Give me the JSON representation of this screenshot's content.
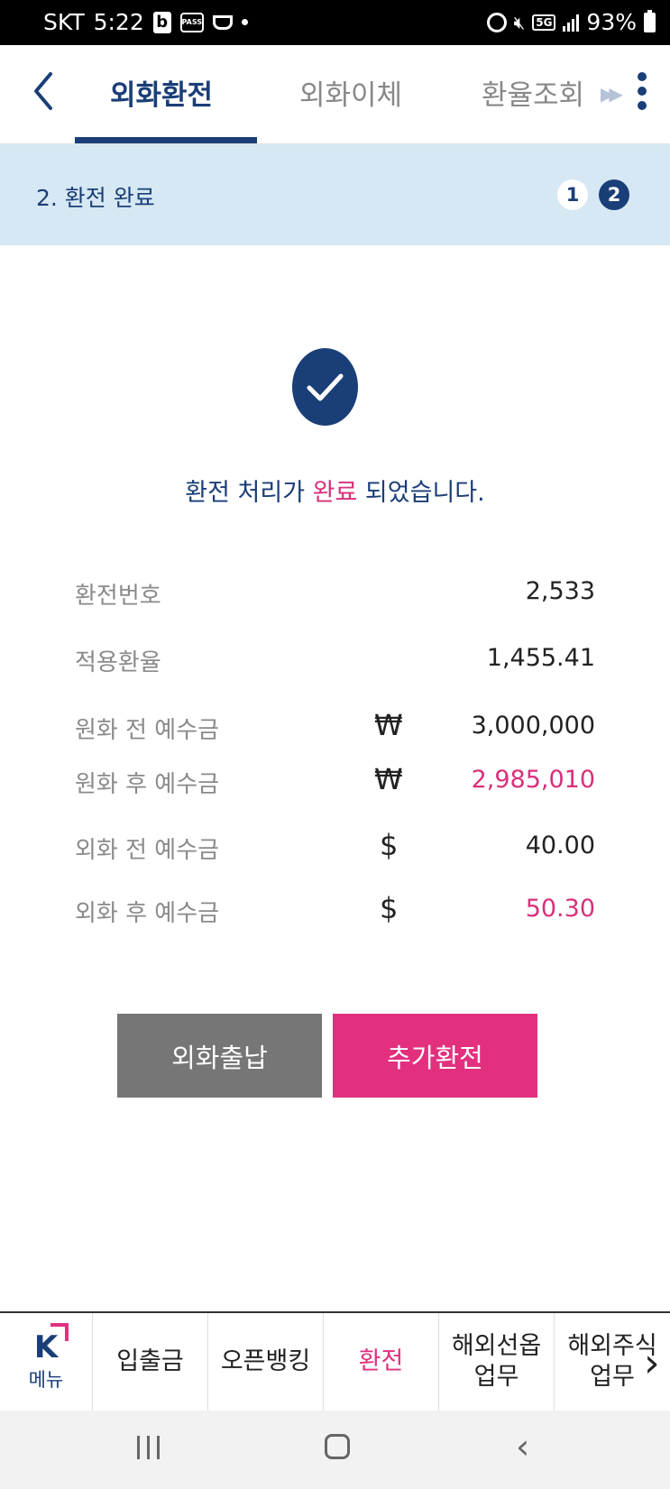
{
  "status_bar": {
    "carrier": "SKT",
    "time": "5:22",
    "network": "5G",
    "battery": "93%"
  },
  "header": {
    "tabs": [
      {
        "label": "외화환전",
        "active": true
      },
      {
        "label": "외화이체",
        "active": false
      },
      {
        "label": "환율조회",
        "active": false
      }
    ]
  },
  "step": {
    "title": "2. 환전 완료",
    "steps": [
      "1",
      "2"
    ],
    "current": 2
  },
  "result": {
    "message_pre": "환전 처리가 ",
    "message_highlight": "완료",
    "message_post": " 되었습니다."
  },
  "details": [
    {
      "label": "환전번호",
      "currency": "",
      "value": "2,533",
      "highlight": false
    },
    {
      "label": "적용환율",
      "currency": "",
      "value": "1,455.41",
      "highlight": false
    },
    {
      "label": "원화 전 예수금",
      "currency": "₩",
      "value": "3,000,000",
      "highlight": false
    },
    {
      "label": "원화 후 예수금",
      "currency": "₩",
      "value": "2,985,010",
      "highlight": true
    },
    {
      "label": "외화 전 예수금",
      "currency": "$",
      "value": "40.00",
      "highlight": false
    },
    {
      "label": "외화 후 예수금",
      "currency": "$",
      "value": "50.30",
      "highlight": true
    }
  ],
  "buttons": {
    "fx_deposit": "외화출납",
    "additional_exchange": "추가환전"
  },
  "bottom_nav": {
    "menu_logo": "K",
    "menu_label": "메뉴",
    "items": [
      {
        "label": "입출금",
        "active": false
      },
      {
        "label": "오픈뱅킹",
        "active": false
      },
      {
        "label": "환전",
        "active": true
      },
      {
        "label_line1": "해외선옵",
        "label_line2": "업무",
        "active": false
      },
      {
        "label_line1": "해외주식",
        "label_line2": "업무",
        "active": false
      }
    ]
  },
  "colors": {
    "navy": "#1a3e77",
    "pink": "#e2307f",
    "step_bg": "#d6e8f3",
    "gray_button": "#767676"
  }
}
